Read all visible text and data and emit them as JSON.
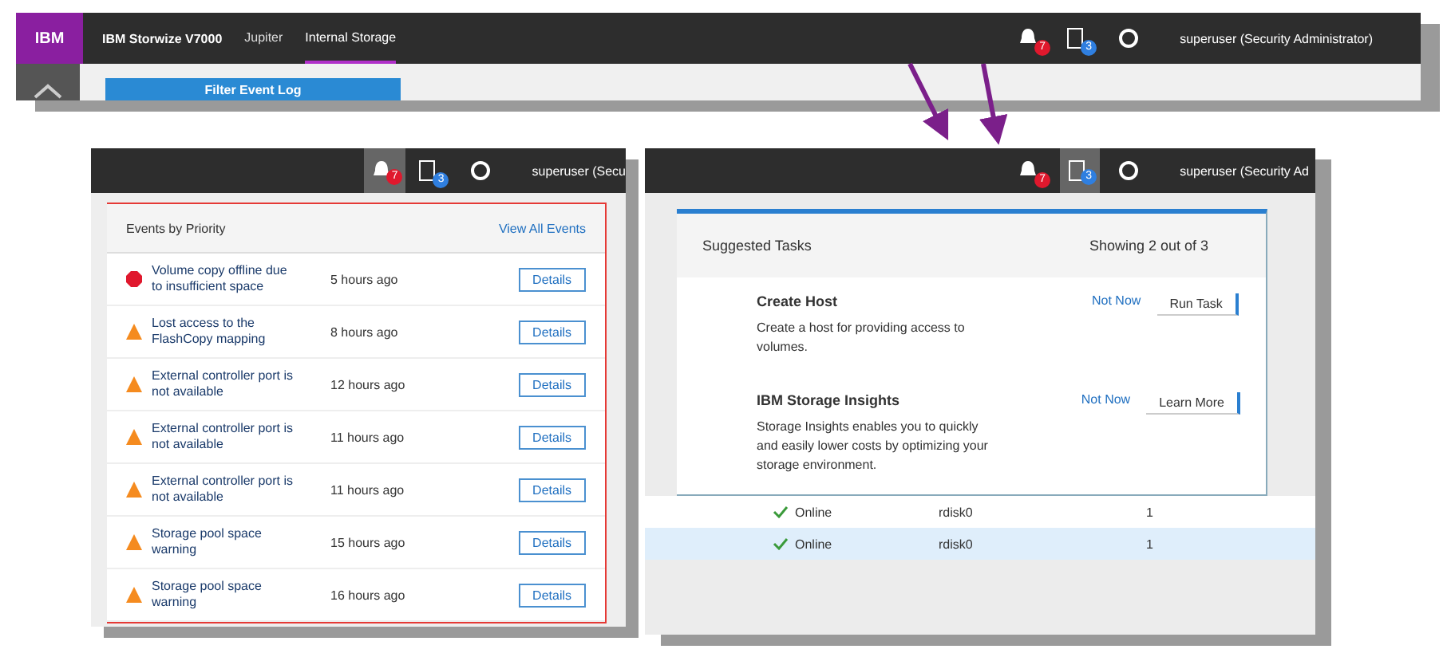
{
  "top_bar": {
    "logo": "IBM",
    "product": "IBM Storwize V7000",
    "tabs": [
      {
        "label": "Jupiter",
        "selected": false
      },
      {
        "label": "Internal Storage",
        "selected": true
      }
    ],
    "events_badge": "7",
    "tasks_badge": "3",
    "user": "superuser (Security Administrator)",
    "filter_button": "Filter Event Log"
  },
  "events_panel": {
    "events_badge": "7",
    "tasks_badge": "3",
    "user": "superuser (Secu",
    "title": "Events by Priority",
    "view_all": "View All Events",
    "events": [
      {
        "kind": "error",
        "message": "Volume copy offline due to insufficient space",
        "time": "5 hours ago",
        "action": "Details"
      },
      {
        "kind": "warning",
        "message": "Lost access to the FlashCopy mapping",
        "time": "8 hours ago",
        "action": "Details"
      },
      {
        "kind": "warning",
        "message": "External controller port is not available",
        "time": "12 hours ago",
        "action": "Details"
      },
      {
        "kind": "warning",
        "message": "External controller port is not available",
        "time": "11 hours ago",
        "action": "Details"
      },
      {
        "kind": "warning",
        "message": "External controller port is not available",
        "time": "11 hours ago",
        "action": "Details"
      },
      {
        "kind": "warning",
        "message": "Storage pool space warning",
        "time": "15 hours ago",
        "action": "Details"
      },
      {
        "kind": "warning",
        "message": "Storage pool space warning",
        "time": "16 hours ago",
        "action": "Details"
      }
    ]
  },
  "tasks_panel": {
    "events_badge": "7",
    "tasks_badge": "3",
    "user": "superuser (Security Ad",
    "title": "Suggested Tasks",
    "count": "Showing 2 out of 3",
    "tasks": [
      {
        "title": "Create Host",
        "description": "Create a host for providing access to volumes.",
        "dismiss": "Not Now",
        "action": "Run Task"
      },
      {
        "title": "IBM Storage Insights",
        "description": "Storage Insights enables you to quickly and easily lower costs by optimizing your storage environment.",
        "dismiss": "Not Now",
        "action": "Learn More"
      }
    ],
    "rows": [
      {
        "status": "Online",
        "name": "rdisk0",
        "value": "1"
      },
      {
        "status": "Online",
        "name": "rdisk0",
        "value": "1"
      }
    ]
  }
}
